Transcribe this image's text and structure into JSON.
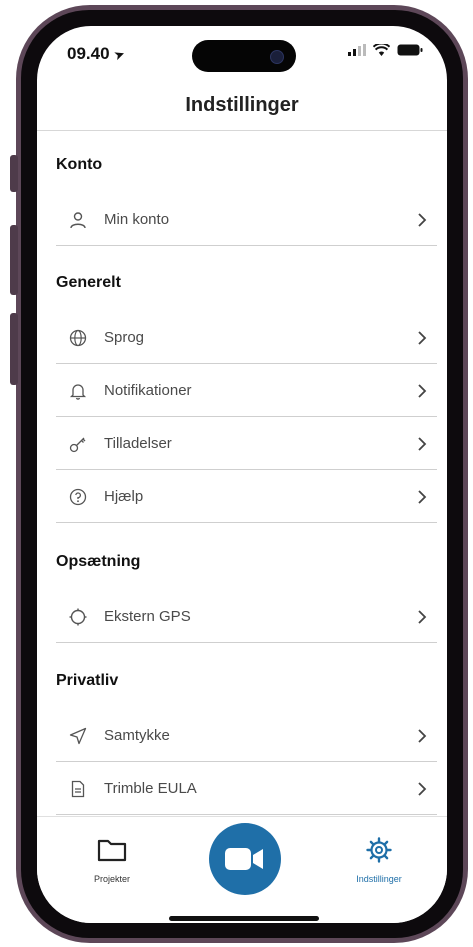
{
  "status_bar": {
    "time": "09.40"
  },
  "nav": {
    "title": "Indstillinger"
  },
  "sections": [
    {
      "title": "Konto",
      "items": [
        {
          "label": "Min konto",
          "icon": "person-icon"
        }
      ]
    },
    {
      "title": "Generelt",
      "items": [
        {
          "label": "Sprog",
          "icon": "globe-icon"
        },
        {
          "label": "Notifikationer",
          "icon": "bell-icon"
        },
        {
          "label": "Tilladelser",
          "icon": "key-icon"
        },
        {
          "label": "Hjælp",
          "icon": "help-icon"
        }
      ]
    },
    {
      "title": "Opsætning",
      "items": [
        {
          "label": "Ekstern GPS",
          "icon": "gps-icon"
        }
      ]
    },
    {
      "title": "Privatliv",
      "items": [
        {
          "label": "Samtykke",
          "icon": "send-icon"
        },
        {
          "label": "Trimble EULA",
          "icon": "document-icon"
        }
      ]
    }
  ],
  "tabbar": {
    "projects_label": "Projekter",
    "settings_label": "Indstillinger",
    "active_tab": "Indstillinger",
    "accent_color": "#1f6fa8"
  },
  "colors": {
    "frame": "#5d4758",
    "record_button": "#1f6fa8"
  }
}
